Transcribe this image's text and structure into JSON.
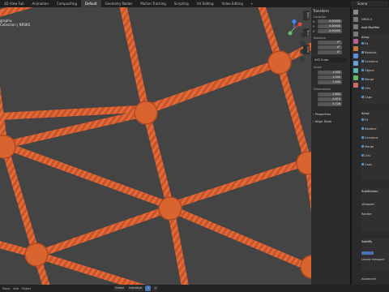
{
  "top_tabs": [
    "3D View Full",
    "Animation",
    "Compositing",
    "Default",
    "Geometry Nodes",
    "Motion Tracking",
    "Scripting",
    "UV Editing",
    "Video Editing"
  ],
  "active_tab": "Default",
  "scene_label": "Scene",
  "viewport": {
    "title": "graphic",
    "subtitle": "Collection | NRSKS",
    "background": "#444444",
    "rope_color": "#e06a3a"
  },
  "npanel": {
    "tabs": [
      "Item",
      "Tool",
      "View"
    ],
    "header": "Transform",
    "location_label": "Location",
    "location": {
      "x": "0.00000",
      "y": "0.00000",
      "z": "0.00000"
    },
    "rotation_label": "Rotation",
    "rotation": {
      "x": "0°",
      "y": "0°",
      "z": "0°"
    },
    "rotation_mode": "XYZ Euler",
    "scale_label": "Scale",
    "scale": {
      "x": "1.000",
      "y": "1.000",
      "z": "1.000"
    },
    "dimensions_label": "Dimensions",
    "dimensions": {
      "x": "1.842",
      "y": "0.874",
      "z": "0.726"
    },
    "sections": [
      "Properties",
      "Align Tools"
    ]
  },
  "properties": {
    "object_name": "NRSK-5",
    "add_modifier": "Add Modifier",
    "modifier_a": {
      "name": "Array",
      "rows": [
        "Fit",
        "Relative",
        "Constant",
        "Object",
        "Merge",
        "UVs",
        "Caps"
      ]
    },
    "modifier_b": {
      "name": "Array",
      "rows": [
        "Fit",
        "Relative",
        "Constant",
        "Merge",
        "UVs",
        "Caps"
      ]
    },
    "modifier_c": {
      "name": "Subdivision",
      "rows": [
        "Viewport",
        "Render"
      ]
    },
    "modifier_d": {
      "name": "Solidify",
      "rows": [
        "Levels Viewport"
      ]
    },
    "advanced": "Advanced"
  },
  "statusbar": {
    "left_items": [
      "Move",
      "Add",
      "Object"
    ],
    "orientation": "Global",
    "pivot": "Individual"
  }
}
